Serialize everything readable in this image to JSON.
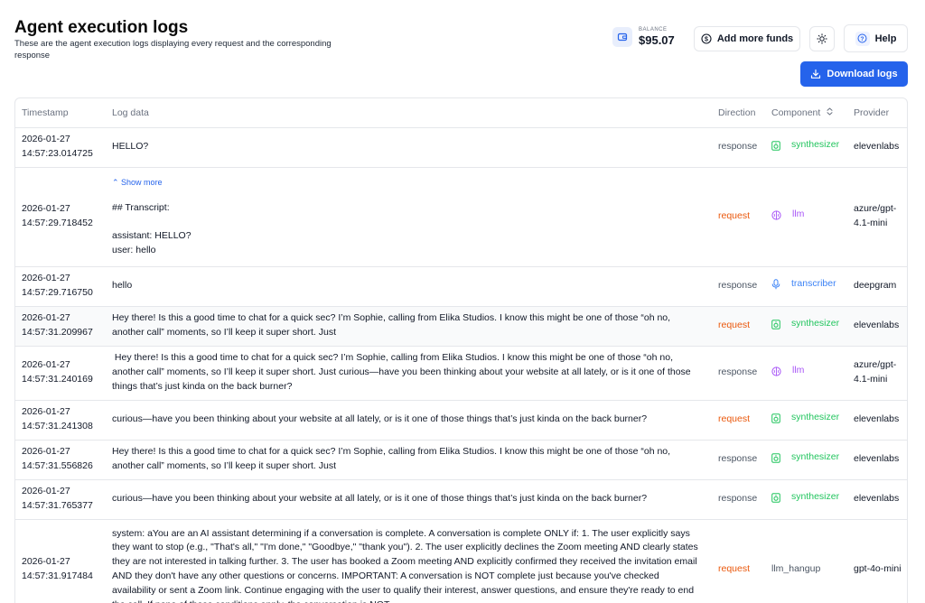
{
  "page": {
    "title": "Agent execution logs",
    "subtitle": "These are the agent execution logs displaying every request and the corresponding response"
  },
  "header": {
    "balance_label": "BALANCE",
    "balance_value": "$95.07",
    "add_funds_label": "Add more funds",
    "help_label": "Help",
    "download_label": "Download logs"
  },
  "colors": {
    "accent": "#2563eb",
    "request": "#ea580c",
    "synthesizer": "#22c55e",
    "llm": "#a855f7",
    "transcriber": "#3b82f6"
  },
  "table": {
    "columns": {
      "timestamp": "Timestamp",
      "log": "Log data",
      "direction": "Direction",
      "component": "Component",
      "provider": "Provider"
    },
    "show_more": "Show more",
    "rows": [
      {
        "ts_date": "2026-01-27",
        "ts_time": "14:57:23.014725",
        "log": "HELLO?",
        "direction": "response",
        "component": "synthesizer",
        "icon": "speaker-icon",
        "provider": "elevenlabs"
      },
      {
        "ts_date": "2026-01-27",
        "ts_time": "14:57:29.718452",
        "log_lines": [
          "## Transcript:",
          "",
          "assistant: HELLO?",
          "user:  hello"
        ],
        "direction": "request",
        "component": "llm",
        "icon": "brain-icon",
        "provider": "azure/gpt-4.1-mini"
      },
      {
        "ts_date": "2026-01-27",
        "ts_time": "14:57:29.716750",
        "log": "hello",
        "direction": "response",
        "component": "transcriber",
        "icon": "microphone-icon",
        "provider": "deepgram"
      },
      {
        "ts_date": "2026-01-27",
        "ts_time": "14:57:31.209967",
        "log": "Hey there! Is this a good time to chat for a quick sec? I’m Sophie, calling from Elika Studios. I know this might be one of those “oh no, another call” moments, so I’ll keep it super short. Just",
        "direction": "request",
        "component": "synthesizer",
        "icon": "speaker-icon",
        "provider": "elevenlabs"
      },
      {
        "ts_date": "2026-01-27",
        "ts_time": "14:57:31.240169",
        "log": " Hey there! Is this a good time to chat for a quick sec? I’m Sophie, calling from Elika Studios. I know this might be one of those “oh no, another call” moments, so I’ll keep it super short. Just curious—have you been thinking about your website at all lately, or is it one of those things that’s just kinda on the back burner?",
        "direction": "response",
        "component": "llm",
        "icon": "brain-icon",
        "provider": "azure/gpt-4.1-mini"
      },
      {
        "ts_date": "2026-01-27",
        "ts_time": "14:57:31.241308",
        "log": "curious—have you been thinking about your website at all lately, or is it one of those things that’s just kinda on the back burner?",
        "direction": "request",
        "component": "synthesizer",
        "icon": "speaker-icon",
        "provider": "elevenlabs"
      },
      {
        "ts_date": "2026-01-27",
        "ts_time": "14:57:31.556826",
        "log": "Hey there! Is this a good time to chat for a quick sec? I’m Sophie, calling from Elika Studios. I know this might be one of those “oh no, another call” moments, so I’ll keep it super short. Just",
        "direction": "response",
        "component": "synthesizer",
        "icon": "speaker-icon",
        "provider": "elevenlabs"
      },
      {
        "ts_date": "2026-01-27",
        "ts_time": "14:57:31.765377",
        "log": "curious—have you been thinking about your website at all lately, or is it one of those things that’s just kinda on the back burner?",
        "direction": "response",
        "component": "synthesizer",
        "icon": "speaker-icon",
        "provider": "elevenlabs"
      },
      {
        "ts_date": "2026-01-27",
        "ts_time": "14:57:31.917484",
        "log": "system: aYou are an AI assistant determining if a conversation is complete. A conversation is complete ONLY if: 1. The user explicitly says they want to stop (e.g., \"That's all,\" \"I'm done,\" \"Goodbye,\" \"thank you\"). 2. The user explicitly declines the Zoom meeting AND clearly states they are not interested in talking further. 3. The user has booked a Zoom meeting AND explicitly confirmed they received the invitation email AND they don't have any other questions or concerns. IMPORTANT: A conversation is NOT complete just because you've checked availability or sent a Zoom link. Continue engaging with the user to qualify their interest, answer questions, and ensure they're ready to end the call. If none of those conditions apply, the conversation is NOT",
        "direction": "request",
        "component": "llm_hangup",
        "icon": "",
        "provider": "gpt-4o-mini"
      }
    ]
  }
}
